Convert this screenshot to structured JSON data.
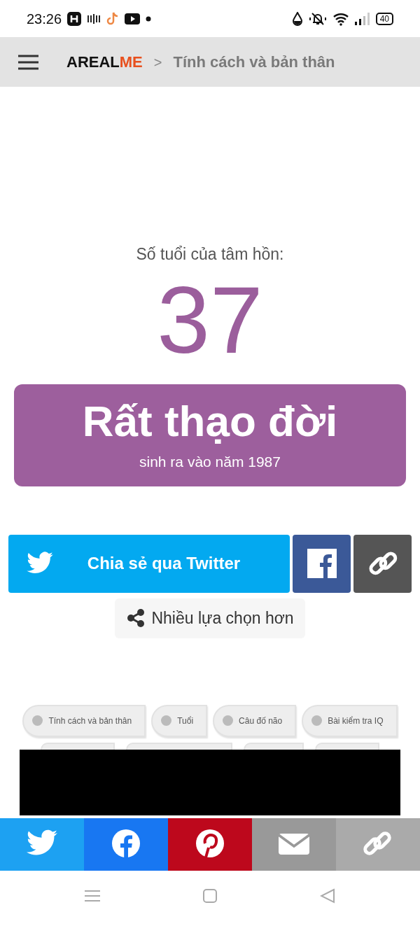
{
  "status_bar": {
    "time": "23:26",
    "battery": "40"
  },
  "header": {
    "brand_dark": "AREAL",
    "brand_accent": "ME",
    "separator": ">",
    "breadcrumb": "Tính cách và bản thân"
  },
  "result": {
    "label": "Số tuổi của tâm hồn:",
    "age": "37",
    "title": "Rất thạo đời",
    "subtitle": "sinh ra vào năm 1987"
  },
  "share": {
    "twitter_label": "Chia sẻ qua Twitter",
    "more_label": "Nhiều lựa chọn hơn"
  },
  "tags": [
    {
      "label": "Tính cách và bản thân"
    },
    {
      "label": "Tuổi"
    },
    {
      "label": "Câu đố não"
    },
    {
      "label": "Bài kiểm tra IQ"
    }
  ],
  "share_bar": [
    {
      "kind": "twitter"
    },
    {
      "kind": "facebook"
    },
    {
      "kind": "pinterest"
    },
    {
      "kind": "email"
    },
    {
      "kind": "link"
    }
  ]
}
